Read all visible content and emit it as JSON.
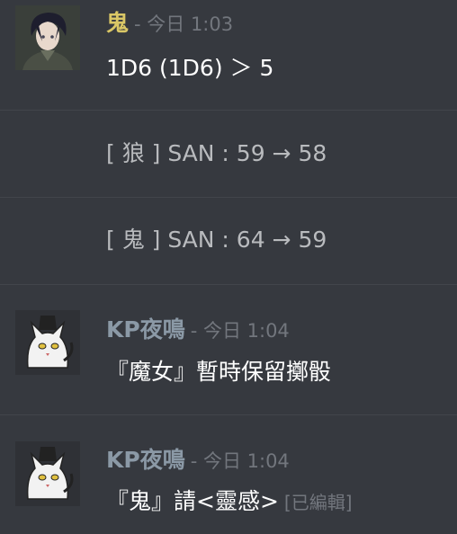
{
  "messages": [
    {
      "author": "鬼",
      "author_color": "#dac766",
      "timestamp": "- 今日 1:03",
      "text": "1D6  (1D6) ＞ 5",
      "avatar": "dark-haired-character-avatar"
    },
    {
      "text": "[ 狼 ] SAN : 59 → 58"
    },
    {
      "text": "[ 鬼 ] SAN : 64 → 59"
    },
    {
      "author": "KP夜鳴",
      "author_color": "#8b99a6",
      "timestamp": "- 今日 1:04",
      "text": "『魔女』暫時保留擲骰",
      "avatar": "white-cat-avatar"
    },
    {
      "author": "KP夜鳴",
      "author_color": "#8b99a6",
      "timestamp": "- 今日 1:04",
      "text": "『鬼』請<靈感>",
      "edited": "[已編輯]",
      "avatar": "white-cat-avatar"
    }
  ]
}
